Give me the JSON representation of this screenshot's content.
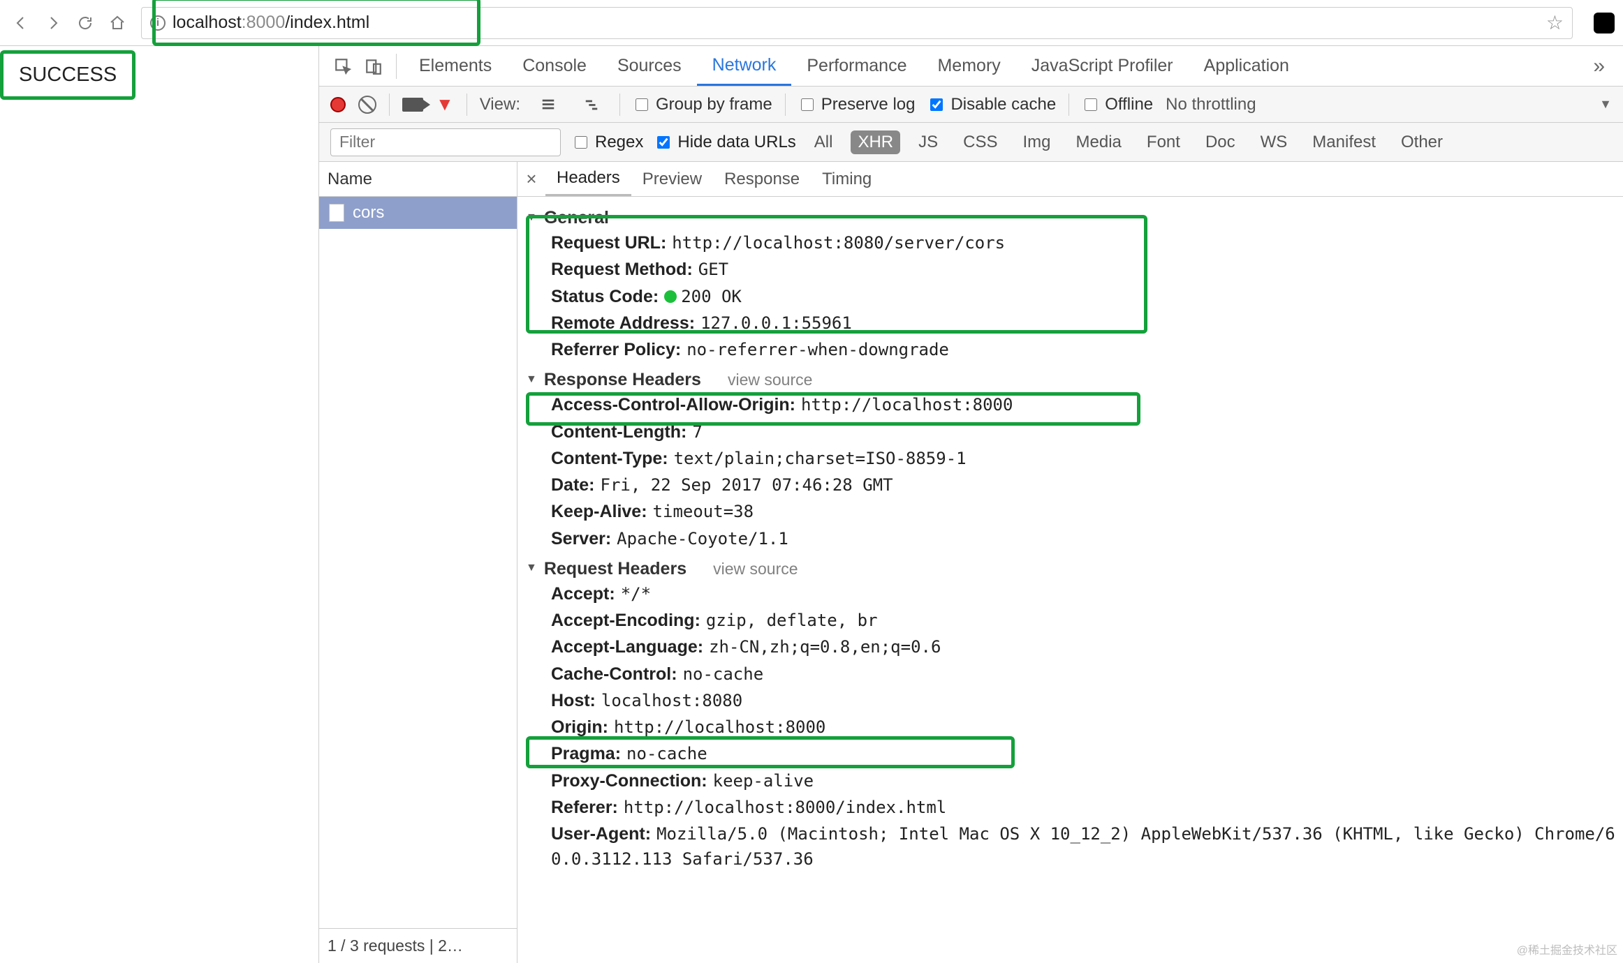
{
  "browser": {
    "url_host": "localhost",
    "url_port": ":8000",
    "url_path": "/index.html"
  },
  "page": {
    "body_text": "SUCCESS"
  },
  "devtools": {
    "tabs": [
      "Elements",
      "Console",
      "Sources",
      "Network",
      "Performance",
      "Memory",
      "JavaScript Profiler",
      "Application"
    ],
    "active_tab": "Network"
  },
  "net_toolbar": {
    "view_label": "View:",
    "group_by_frame": "Group by frame",
    "preserve_log": "Preserve log",
    "disable_cache": "Disable cache",
    "offline": "Offline",
    "throttling": "No throttling"
  },
  "filter_row": {
    "placeholder": "Filter",
    "regex": "Regex",
    "hide_data_urls": "Hide data URLs",
    "types": [
      "All",
      "XHR",
      "JS",
      "CSS",
      "Img",
      "Media",
      "Font",
      "Doc",
      "WS",
      "Manifest",
      "Other"
    ],
    "active_type": "XHR"
  },
  "request_list": {
    "header": "Name",
    "items": [
      "cors"
    ],
    "footer": "1 / 3 requests | 2…"
  },
  "detail_tabs": [
    "Headers",
    "Preview",
    "Response",
    "Timing"
  ],
  "detail_active": "Headers",
  "headers": {
    "general_title": "General",
    "general": {
      "Request URL": "http://localhost:8080/server/cors",
      "Request Method": "GET",
      "Status Code": "200 OK",
      "Remote Address": "127.0.0.1:55961",
      "Referrer Policy": "no-referrer-when-downgrade"
    },
    "response_title": "Response Headers",
    "view_source": "view source",
    "response": {
      "Access-Control-Allow-Origin": "http://localhost:8000",
      "Content-Length": "7",
      "Content-Type": "text/plain;charset=ISO-8859-1",
      "Date": "Fri, 22 Sep 2017 07:46:28 GMT",
      "Keep-Alive": "timeout=38",
      "Server": "Apache-Coyote/1.1"
    },
    "request_title": "Request Headers",
    "request": {
      "Accept": "*/*",
      "Accept-Encoding": "gzip, deflate, br",
      "Accept-Language": "zh-CN,zh;q=0.8,en;q=0.6",
      "Cache-Control": "no-cache",
      "Host": "localhost:8080",
      "Origin": "http://localhost:8000",
      "Pragma": "no-cache",
      "Proxy-Connection": "keep-alive",
      "Referer": "http://localhost:8000/index.html",
      "User-Agent": "Mozilla/5.0 (Macintosh; Intel Mac OS X 10_12_2) AppleWebKit/537.36 (KHTML, like Gecko) Chrome/60.0.3112.113 Safari/537.36"
    }
  },
  "watermark": "@稀土掘金技术社区"
}
